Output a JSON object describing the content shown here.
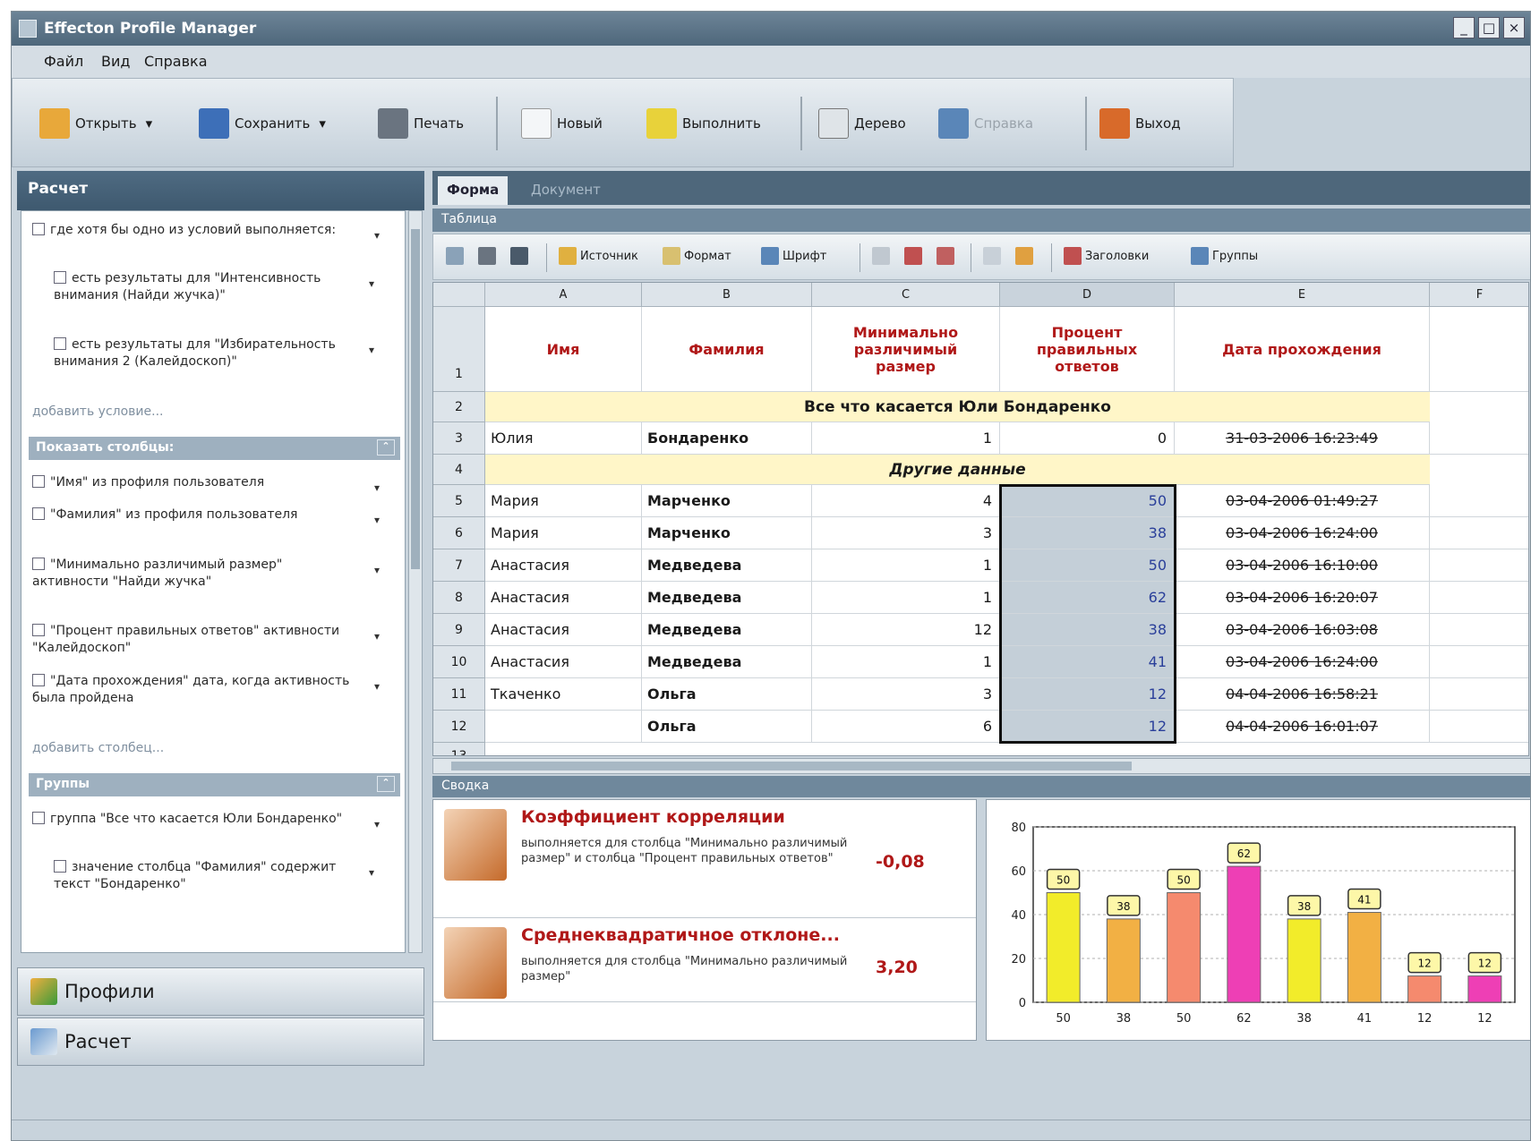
{
  "window": {
    "title": "Effecton Profile Manager",
    "controls": [
      "_",
      "□",
      "×"
    ]
  },
  "menu": [
    "Файл",
    "Вид",
    "Справка"
  ],
  "toolbar": {
    "buttons": [
      {
        "label": "Открыть",
        "icon": "folder-open-icon",
        "color": "#e8a83a"
      },
      {
        "label": "Сохранить",
        "icon": "save-icon",
        "color": "#3d6fb8"
      },
      {
        "label": "Печать",
        "icon": "print-icon",
        "color": "#6a7480"
      },
      {
        "label": "Новый",
        "icon": "new-document-icon",
        "color": "#f4f6f8"
      },
      {
        "label": "Выполнить",
        "icon": "run-icon",
        "color": "#e8d23a"
      },
      {
        "label": "Дерево",
        "icon": "tree-icon",
        "color": "#dfe4e8"
      },
      {
        "label": "Справка",
        "icon": "help-icon",
        "color": "#5a86b8"
      },
      {
        "label": "Выход",
        "icon": "exit-icon",
        "color": "#d86a2a"
      }
    ]
  },
  "left": {
    "header": "Расчет",
    "conditions": [
      "где хотя бы одно из условий выполняется:",
      "есть результаты для \"Интенсивность внимания (Найди жучка)\"",
      "есть результаты для \"Избирательность внимания 2 (Калейдоскоп)\""
    ],
    "add_condition": "добавить условие...",
    "columns_header": "Показать столбцы:",
    "columns": [
      "\"Имя\" из профиля пользователя",
      "\"Фамилия\" из профиля пользователя",
      "\"Минимально различимый размер\" активности \"Найди жучка\"",
      "\"Процент правильных ответов\" активности \"Калейдоскоп\"",
      "\"Дата прохождения\" дата, когда активность была пройдена"
    ],
    "add_column": "добавить столбец...",
    "groups_header": "Группы",
    "groups": [
      "группа \"Все что касается Юли Бондаренко\"",
      "значение столбца \"Фамилия\" содержит текст \"Бондаренко\""
    ],
    "nav": [
      {
        "label": "Профили",
        "icon": "profiles-icon"
      },
      {
        "label": "Расчет",
        "icon": "calc-icon"
      }
    ]
  },
  "tabs": [
    "Форма",
    "Документ"
  ],
  "table_bar": "Таблица",
  "grid_toolbar": {
    "items": [
      {
        "label": "",
        "icon": "copy-icon"
      },
      {
        "label": "",
        "icon": "cut-icon"
      },
      {
        "label": "",
        "icon": "paste-icon"
      },
      {
        "label": "Источник",
        "icon": "source-icon"
      },
      {
        "label": "Формат",
        "icon": "format-icon"
      },
      {
        "label": "Шрифт",
        "icon": "font-icon"
      },
      {
        "label": "",
        "icon": "insert-column-icon"
      },
      {
        "label": "",
        "icon": "delete-column-icon"
      },
      {
        "label": "",
        "icon": "delete-row-icon"
      },
      {
        "label": "",
        "icon": "merge-icon"
      },
      {
        "label": "",
        "icon": "chart-icon"
      },
      {
        "label": "Заголовки",
        "icon": "headers-icon"
      },
      {
        "label": "Группы",
        "icon": "groups-icon"
      }
    ]
  },
  "grid": {
    "col_letters": [
      "A",
      "B",
      "C",
      "D",
      "E",
      "F"
    ],
    "headers": [
      "Имя",
      "Фамилия",
      "Минимально различимый размер",
      "Процент правильных ответов",
      "Дата прохождения"
    ],
    "group1": "Все что касается Юли Бондаренко",
    "group2": "Другие данные",
    "rows": [
      {
        "n": "3",
        "name": "Юлия",
        "surname": "Бондаренко",
        "size": "1",
        "pct": "0",
        "date": "31-03-2006 16:23:49"
      },
      {
        "n": "5",
        "name": "Мария",
        "surname": "Марченко",
        "size": "4",
        "pct": "50",
        "date": "03-04-2006 01:49:27"
      },
      {
        "n": "6",
        "name": "Мария",
        "surname": "Марченко",
        "size": "3",
        "pct": "38",
        "date": "03-04-2006 16:24:00"
      },
      {
        "n": "7",
        "name": "Анастасия",
        "surname": "Медведева",
        "size": "1",
        "pct": "50",
        "date": "03-04-2006 16:10:00"
      },
      {
        "n": "8",
        "name": "Анастасия",
        "surname": "Медведева",
        "size": "1",
        "pct": "62",
        "date": "03-04-2006 16:20:07"
      },
      {
        "n": "9",
        "name": "Анастасия",
        "surname": "Медведева",
        "size": "12",
        "pct": "38",
        "date": "03-04-2006 16:03:08"
      },
      {
        "n": "10",
        "name": "Анастасия",
        "surname": "Медведева",
        "size": "1",
        "pct": "41",
        "date": "03-04-2006 16:24:00"
      },
      {
        "n": "11",
        "name": "Ткаченко",
        "surname": "Ольга",
        "size": "3",
        "pct": "12",
        "date": "04-04-2006 16:58:21"
      },
      {
        "n": "12",
        "name": "",
        "surname": "Ольга",
        "size": "6",
        "pct": "12",
        "date": "04-04-2006 16:01:07"
      }
    ]
  },
  "svodka": "Сводка",
  "stats": [
    {
      "title": "Коэффициент корреляции",
      "desc": "выполняется для столбца \"Минимально различимый размер\" и столбца \"Процент правильных ответов\"",
      "value": "-0,08",
      "icon": "correlation-icon"
    },
    {
      "title": "Среднеквадратичное отклоне...",
      "desc": "выполняется для столбца \"Минимально различимый размер\"",
      "value": "3,20",
      "icon": "deviation-icon"
    }
  ],
  "chart_data": {
    "type": "bar",
    "categories": [
      "50",
      "38",
      "50",
      "62",
      "38",
      "41",
      "12",
      "12"
    ],
    "values": [
      50,
      38,
      50,
      62,
      38,
      41,
      12,
      12
    ],
    "data_labels": [
      "50",
      "38",
      "50",
      "62",
      "38",
      "41",
      "12",
      "12"
    ],
    "colors": [
      "#f2ec2a",
      "#f2b044",
      "#f58a6e",
      "#ee3fb5",
      "#f2ec2a",
      "#f2b044",
      "#f58a6e",
      "#ee3fb5"
    ],
    "yticks": [
      "0",
      "20",
      "40",
      "60",
      "80"
    ],
    "ylim": [
      0,
      80
    ],
    "grid": true,
    "title": "",
    "xlabel": "",
    "ylabel": ""
  }
}
